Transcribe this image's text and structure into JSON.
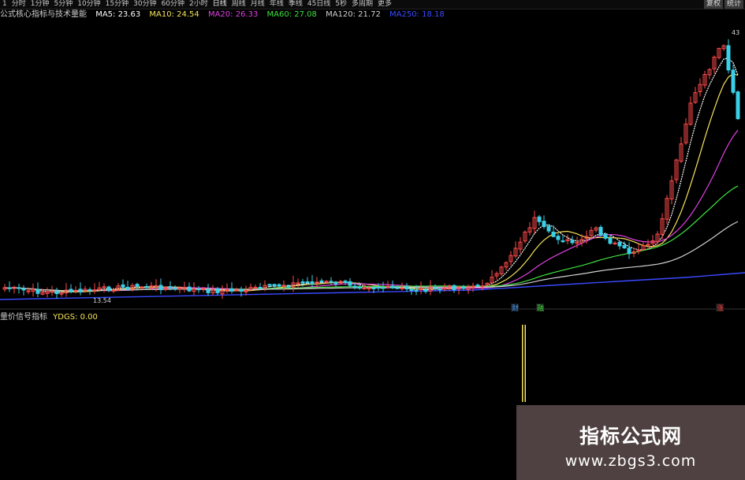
{
  "period_bar": {
    "items": [
      "1",
      "分时",
      "1分钟",
      "5分钟",
      "10分钟",
      "15分钟",
      "30分钟",
      "60分钟",
      "2小时",
      "日线",
      "周线",
      "月线",
      "年线",
      "季线",
      "45日线",
      "5秒",
      "多周期",
      "更多"
    ],
    "active_index": 9,
    "right_buttons": [
      "复权",
      "统计"
    ]
  },
  "main_legend": {
    "title": "公式核心指标与技术量能",
    "items": [
      {
        "label": "MA5: 23.63",
        "color": "#ffffff"
      },
      {
        "label": "MA10: 24.54",
        "color": "#f5e35a"
      },
      {
        "label": "MA20: 26.33",
        "color": "#e040e0"
      },
      {
        "label": "MA60: 27.08",
        "color": "#40e040"
      },
      {
        "label": "MA120: 21.72",
        "color": "#d0d0d0"
      },
      {
        "label": "MA250: 18.18",
        "color": "#3a4aff"
      }
    ]
  },
  "price_labels": {
    "high": "43",
    "low": "13.54"
  },
  "signal_markers": [
    {
      "text": "财",
      "color": "#40a0ff"
    },
    {
      "text": "融",
      "color": "#40e040"
    },
    {
      "text": "涨",
      "color": "#ff4040"
    }
  ],
  "sub_legend": {
    "title": "量价信号指标",
    "items": [
      {
        "label": "YDGS: 0.00",
        "color": "#f5e35a"
      }
    ]
  },
  "watermark": {
    "title": "指标公式网",
    "url": "www.zbgs3.com"
  },
  "colors": {
    "up": "#ff4a4a",
    "down": "#3ad0e8",
    "background": "#000000",
    "divider": "#333333"
  }
}
